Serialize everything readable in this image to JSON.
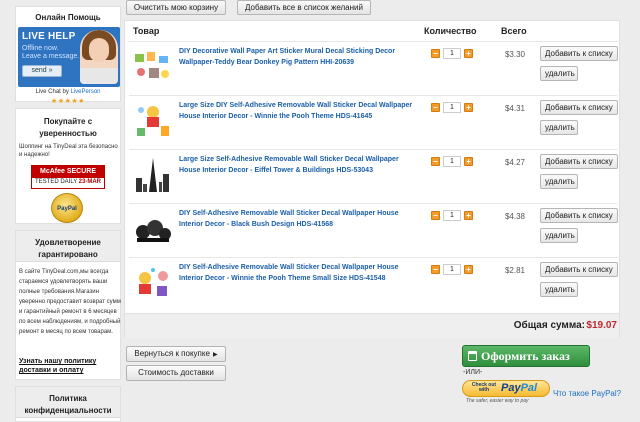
{
  "sidebar": {
    "help": {
      "title": "Онлайн Помощь",
      "banner_title": "LIVE HELP",
      "offline": "Offline now.",
      "leave": "Leave a message.",
      "send": "send »",
      "live_chat_by": "Live Chat by",
      "liveperson": "LivePerson",
      "stars": "★★★★★"
    },
    "buy": {
      "title": "Покупайте с уверенностью",
      "text": "Шоппинг на TinyDeal эта безопасно и надежно!",
      "mcafee_label": "McAfee SECURE",
      "mcafee_tested": "TESTED DAILY",
      "mcafee_date": "23-MAR",
      "paypal_seal": "PayPal"
    },
    "guarantee": {
      "title": "Удовлетворение гарантировано",
      "text": "В сайте TinyDeal.com,мы всегда стараемся удовлетворять ваши полные требования.Магазин уверенно предоставит возврат сумм и гарантийный ремонт в 6 месяцев по всем наблюдениям, и подробный ремонт в месяц по всем товарам.",
      "link": "Узнать нашу политику доставки и оплату"
    },
    "policy": {
      "title": "Политика конфиденциальности"
    }
  },
  "toolbar": {
    "clear_cart": "Очистить мою корзину",
    "add_all_wishlist": "Добавить все в список желаний"
  },
  "cart": {
    "headers": {
      "product": "Товар",
      "quantity": "Количество",
      "total": "Всего"
    },
    "items": [
      {
        "name": "DIY Decorative Wall Paper Art Sticker Mural Decal Sticking Decor Wallpaper-Teddy Bear Donkey Pig Pattern HHI-20639",
        "qty": "1",
        "price": "$3.30"
      },
      {
        "name": "Large Size DIY Self-Adhesive Removable Wall Sticker Decal Wallpaper House Interior Decor - Winnie the Pooh Theme HDS-41645",
        "qty": "1",
        "price": "$4.31"
      },
      {
        "name": "Large Size Self-Adhesive Removable Wall Sticker Decal Wallpaper House Interior Decor - Eiffel Tower & Buildings HDS-53043",
        "qty": "1",
        "price": "$4.27"
      },
      {
        "name": "DIY Self-Adhesive Removable Wall Sticker Decal Wallpaper House Interior Decor - Black Bush Design HDS-41568",
        "qty": "1",
        "price": "$4.38"
      },
      {
        "name": "DIY Self-Adhesive Removable Wall Sticker Decal Wallpaper House Interior Decor - Winnie the Pooh Theme Small Size HDS-41548",
        "qty": "1",
        "price": "$2.81"
      }
    ],
    "wish_label": "Добавить к списку",
    "delete_label": "удалить",
    "minus": "−",
    "plus": "+",
    "sum_label": "Общая сумма:",
    "sum_value": "$19.07"
  },
  "actions": {
    "continue": "Вернуться к покупке",
    "shipping": "Стоимость доставки",
    "checkout": "Оформить заказ",
    "or": "-ИЛИ-",
    "pp_checkout": "Check out with",
    "pp_pay": "Pay",
    "pp_pal": "Pal",
    "pp_tagline": "The safer, easier way to pay",
    "pp_what": "Что такое PayPal?"
  },
  "colors": {
    "link": "#1a5fa8",
    "total_red": "#c0272d",
    "checkout_green": "#2f8f3d",
    "qty_orange": "#f39a2a"
  }
}
